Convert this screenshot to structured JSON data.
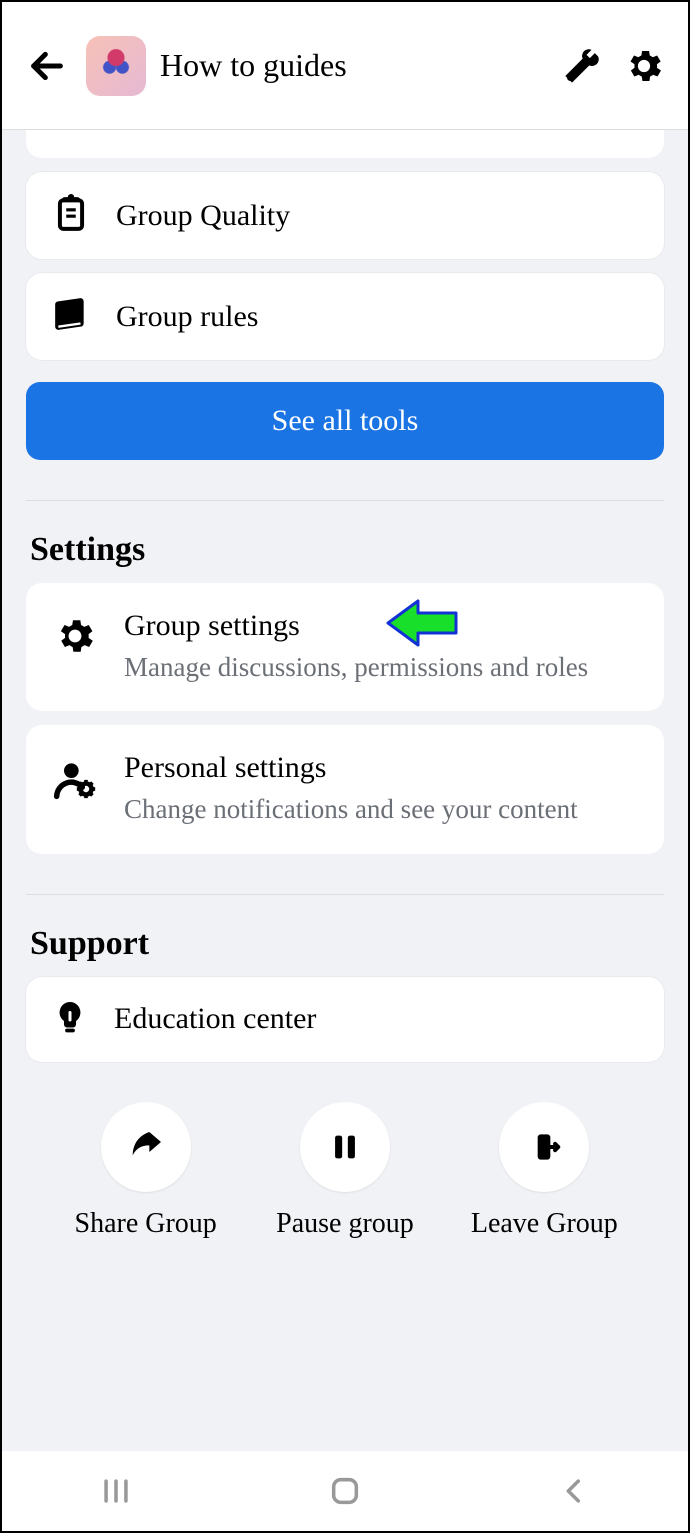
{
  "header": {
    "title": "How to guides"
  },
  "tool_items": [
    {
      "icon": "clipboard-icon",
      "label": "Group Quality"
    },
    {
      "icon": "book-icon",
      "label": "Group rules"
    }
  ],
  "see_all_button": "See all tools",
  "settings": {
    "title": "Settings",
    "items": [
      {
        "icon": "gear-icon",
        "title": "Group settings",
        "subtitle": "Manage discussions, permissions and roles",
        "highlighted": true
      },
      {
        "icon": "user-gear-icon",
        "title": "Personal settings",
        "subtitle": "Change notifications and see your content",
        "highlighted": false
      }
    ]
  },
  "support": {
    "title": "Support",
    "items": [
      {
        "icon": "bulb-icon",
        "label": "Education center"
      }
    ]
  },
  "actions": [
    {
      "icon": "share-icon",
      "label": "Share Group"
    },
    {
      "icon": "pause-icon",
      "label": "Pause group"
    },
    {
      "icon": "leave-icon",
      "label": "Leave Group"
    }
  ]
}
